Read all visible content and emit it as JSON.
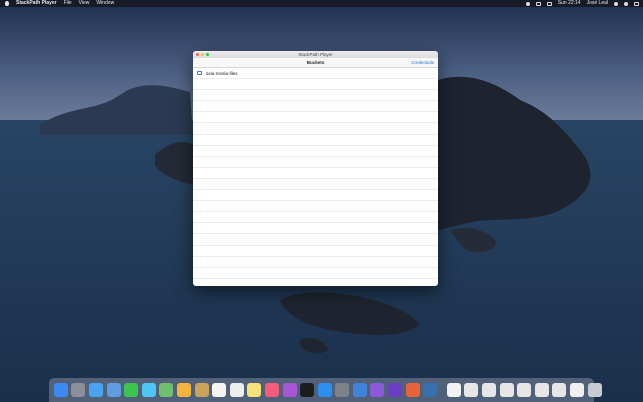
{
  "menubar": {
    "app_name": "StackPath Player",
    "menus": [
      "File",
      "View",
      "Window"
    ],
    "clock": "Sun 22:14",
    "user": "José Leal"
  },
  "window": {
    "title": "StackPath Player",
    "nav_title": "Buckets",
    "nav_action": "Credentials",
    "rows": [
      {
        "label": "asia-media-files",
        "icon": "folder-icon"
      }
    ],
    "empty_rows": 19
  },
  "dock": {
    "apps": [
      {
        "name": "finder-icon",
        "color": "#3d8bf2"
      },
      {
        "name": "launchpad-icon",
        "color": "#8a8f99"
      },
      {
        "name": "safari-icon",
        "color": "#4aa3f0"
      },
      {
        "name": "mail-icon",
        "color": "#5f9de0"
      },
      {
        "name": "facetime-icon",
        "color": "#3cc44f"
      },
      {
        "name": "messages-icon",
        "color": "#4ec5f5"
      },
      {
        "name": "maps-icon",
        "color": "#6fbf73"
      },
      {
        "name": "photos-icon",
        "color": "#f3b33d"
      },
      {
        "name": "notes-icon",
        "color": "#c9a35a"
      },
      {
        "name": "calendar-icon",
        "color": "#f4f4f4"
      },
      {
        "name": "reminders-icon",
        "color": "#eeeeee"
      },
      {
        "name": "stickies-icon",
        "color": "#f6e27a"
      },
      {
        "name": "music-icon",
        "color": "#f35c7a"
      },
      {
        "name": "podcasts-icon",
        "color": "#a855d8"
      },
      {
        "name": "tv-icon",
        "color": "#1d1d1f"
      },
      {
        "name": "app-store-icon",
        "color": "#2d8ef0"
      },
      {
        "name": "system-preferences-icon",
        "color": "#7d828a"
      },
      {
        "name": "xcode-icon",
        "color": "#3f84d9"
      },
      {
        "name": "visual-studio-icon",
        "color": "#8c5ad9"
      },
      {
        "name": "visual-studio-code-icon",
        "color": "#6a3fc4"
      },
      {
        "name": "tools-icon",
        "color": "#e8633a"
      },
      {
        "name": "sourcetree-icon",
        "color": "#3a6fae"
      }
    ],
    "docs": [
      {
        "name": "document-icon",
        "color": "#f2f2f2"
      },
      {
        "name": "window-thumbnail-icon",
        "color": "#e6e6e6"
      },
      {
        "name": "window-thumbnail-icon",
        "color": "#e6e6e6"
      },
      {
        "name": "window-thumbnail-icon",
        "color": "#e6e6e6"
      },
      {
        "name": "window-thumbnail-icon",
        "color": "#e6e6e6"
      },
      {
        "name": "window-thumbnail-icon",
        "color": "#e6e6e6"
      },
      {
        "name": "window-thumbnail-icon",
        "color": "#e6e6e6"
      },
      {
        "name": "file-icon",
        "color": "#f0f0f0"
      },
      {
        "name": "trash-icon",
        "color": "#c8ccd2"
      }
    ]
  }
}
